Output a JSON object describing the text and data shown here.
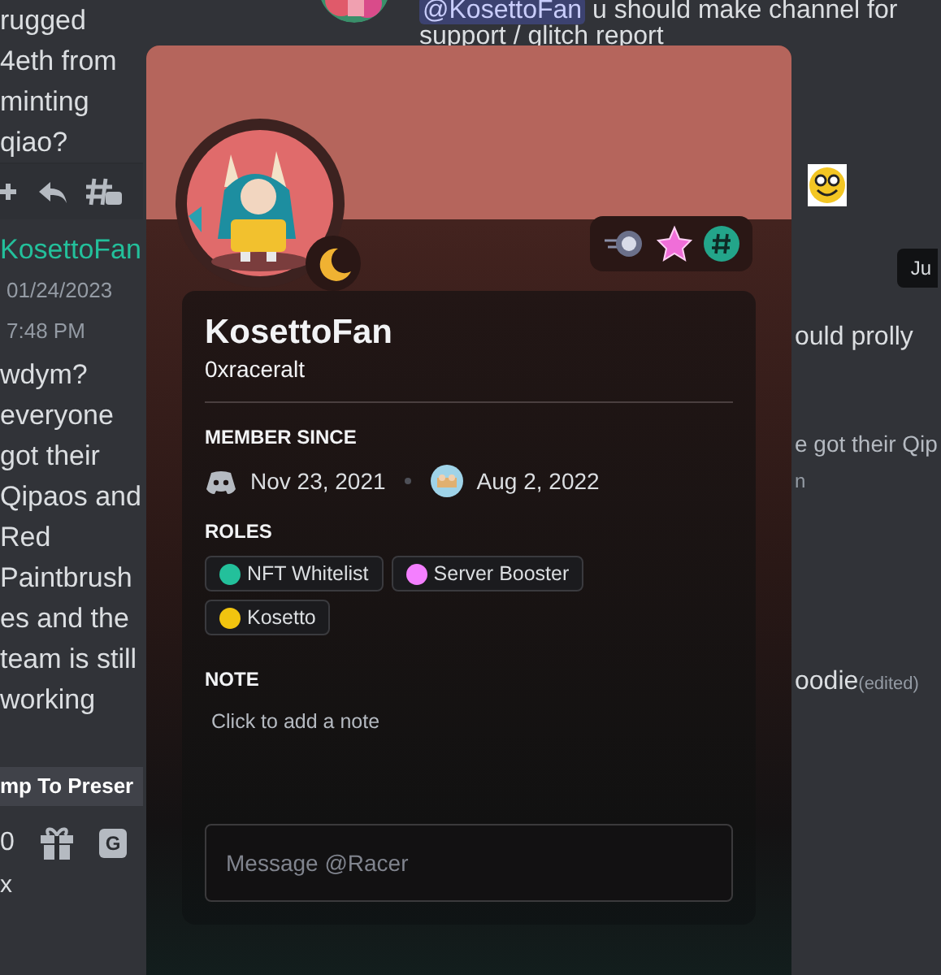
{
  "left_pane": {
    "message_text": "rugged 4eth from minting qiao?",
    "author": "KosettoFan",
    "timestamp": "01/24/2023 7:48 PM",
    "reply_text": "wdym? everyone got their Qipaos and Red Paintbrushes and the team is still working",
    "jump_bar": "mp To Preser",
    "counter": "0",
    "gif_label": "G",
    "footer": "x"
  },
  "chat": {
    "mention": "@KosettoFan",
    "top_text": "u should make channel for",
    "top_text_2": "support / glitch report",
    "tooltip": "Ju",
    "fragments": [
      {
        "text": "ould prolly"
      },
      {
        "text": "e got their Qip"
      },
      {
        "text": "n"
      },
      {
        "text": "oodie",
        "edited": "(edited)"
      }
    ]
  },
  "profile": {
    "display_name": "KosettoFan",
    "username": "0xraceralt",
    "member_since_label": "MEMBER SINCE",
    "discord_date": "Nov 23, 2021",
    "server_date": "Aug 2, 2022",
    "roles_label": "ROLES",
    "roles": [
      {
        "name": "NFT Whitelist",
        "color": "#23c09b"
      },
      {
        "name": "Server Booster",
        "color": "#f47fff"
      },
      {
        "name": "Kosetto",
        "color": "#f1c40f"
      }
    ],
    "note_label": "NOTE",
    "note_placeholder": "Click to add a note",
    "message_placeholder": "Message @Racer"
  }
}
